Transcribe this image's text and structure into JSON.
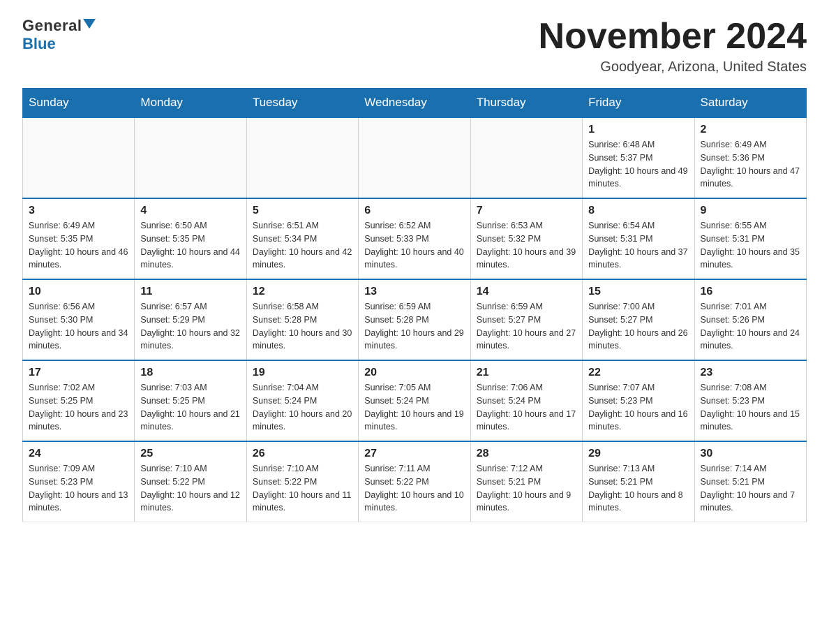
{
  "logo": {
    "general": "General",
    "blue": "Blue"
  },
  "title": "November 2024",
  "subtitle": "Goodyear, Arizona, United States",
  "days_of_week": [
    "Sunday",
    "Monday",
    "Tuesday",
    "Wednesday",
    "Thursday",
    "Friday",
    "Saturday"
  ],
  "weeks": [
    [
      {
        "day": "",
        "info": ""
      },
      {
        "day": "",
        "info": ""
      },
      {
        "day": "",
        "info": ""
      },
      {
        "day": "",
        "info": ""
      },
      {
        "day": "",
        "info": ""
      },
      {
        "day": "1",
        "info": "Sunrise: 6:48 AM\nSunset: 5:37 PM\nDaylight: 10 hours and 49 minutes."
      },
      {
        "day": "2",
        "info": "Sunrise: 6:49 AM\nSunset: 5:36 PM\nDaylight: 10 hours and 47 minutes."
      }
    ],
    [
      {
        "day": "3",
        "info": "Sunrise: 6:49 AM\nSunset: 5:35 PM\nDaylight: 10 hours and 46 minutes."
      },
      {
        "day": "4",
        "info": "Sunrise: 6:50 AM\nSunset: 5:35 PM\nDaylight: 10 hours and 44 minutes."
      },
      {
        "day": "5",
        "info": "Sunrise: 6:51 AM\nSunset: 5:34 PM\nDaylight: 10 hours and 42 minutes."
      },
      {
        "day": "6",
        "info": "Sunrise: 6:52 AM\nSunset: 5:33 PM\nDaylight: 10 hours and 40 minutes."
      },
      {
        "day": "7",
        "info": "Sunrise: 6:53 AM\nSunset: 5:32 PM\nDaylight: 10 hours and 39 minutes."
      },
      {
        "day": "8",
        "info": "Sunrise: 6:54 AM\nSunset: 5:31 PM\nDaylight: 10 hours and 37 minutes."
      },
      {
        "day": "9",
        "info": "Sunrise: 6:55 AM\nSunset: 5:31 PM\nDaylight: 10 hours and 35 minutes."
      }
    ],
    [
      {
        "day": "10",
        "info": "Sunrise: 6:56 AM\nSunset: 5:30 PM\nDaylight: 10 hours and 34 minutes."
      },
      {
        "day": "11",
        "info": "Sunrise: 6:57 AM\nSunset: 5:29 PM\nDaylight: 10 hours and 32 minutes."
      },
      {
        "day": "12",
        "info": "Sunrise: 6:58 AM\nSunset: 5:28 PM\nDaylight: 10 hours and 30 minutes."
      },
      {
        "day": "13",
        "info": "Sunrise: 6:59 AM\nSunset: 5:28 PM\nDaylight: 10 hours and 29 minutes."
      },
      {
        "day": "14",
        "info": "Sunrise: 6:59 AM\nSunset: 5:27 PM\nDaylight: 10 hours and 27 minutes."
      },
      {
        "day": "15",
        "info": "Sunrise: 7:00 AM\nSunset: 5:27 PM\nDaylight: 10 hours and 26 minutes."
      },
      {
        "day": "16",
        "info": "Sunrise: 7:01 AM\nSunset: 5:26 PM\nDaylight: 10 hours and 24 minutes."
      }
    ],
    [
      {
        "day": "17",
        "info": "Sunrise: 7:02 AM\nSunset: 5:25 PM\nDaylight: 10 hours and 23 minutes."
      },
      {
        "day": "18",
        "info": "Sunrise: 7:03 AM\nSunset: 5:25 PM\nDaylight: 10 hours and 21 minutes."
      },
      {
        "day": "19",
        "info": "Sunrise: 7:04 AM\nSunset: 5:24 PM\nDaylight: 10 hours and 20 minutes."
      },
      {
        "day": "20",
        "info": "Sunrise: 7:05 AM\nSunset: 5:24 PM\nDaylight: 10 hours and 19 minutes."
      },
      {
        "day": "21",
        "info": "Sunrise: 7:06 AM\nSunset: 5:24 PM\nDaylight: 10 hours and 17 minutes."
      },
      {
        "day": "22",
        "info": "Sunrise: 7:07 AM\nSunset: 5:23 PM\nDaylight: 10 hours and 16 minutes."
      },
      {
        "day": "23",
        "info": "Sunrise: 7:08 AM\nSunset: 5:23 PM\nDaylight: 10 hours and 15 minutes."
      }
    ],
    [
      {
        "day": "24",
        "info": "Sunrise: 7:09 AM\nSunset: 5:23 PM\nDaylight: 10 hours and 13 minutes."
      },
      {
        "day": "25",
        "info": "Sunrise: 7:10 AM\nSunset: 5:22 PM\nDaylight: 10 hours and 12 minutes."
      },
      {
        "day": "26",
        "info": "Sunrise: 7:10 AM\nSunset: 5:22 PM\nDaylight: 10 hours and 11 minutes."
      },
      {
        "day": "27",
        "info": "Sunrise: 7:11 AM\nSunset: 5:22 PM\nDaylight: 10 hours and 10 minutes."
      },
      {
        "day": "28",
        "info": "Sunrise: 7:12 AM\nSunset: 5:21 PM\nDaylight: 10 hours and 9 minutes."
      },
      {
        "day": "29",
        "info": "Sunrise: 7:13 AM\nSunset: 5:21 PM\nDaylight: 10 hours and 8 minutes."
      },
      {
        "day": "30",
        "info": "Sunrise: 7:14 AM\nSunset: 5:21 PM\nDaylight: 10 hours and 7 minutes."
      }
    ]
  ]
}
